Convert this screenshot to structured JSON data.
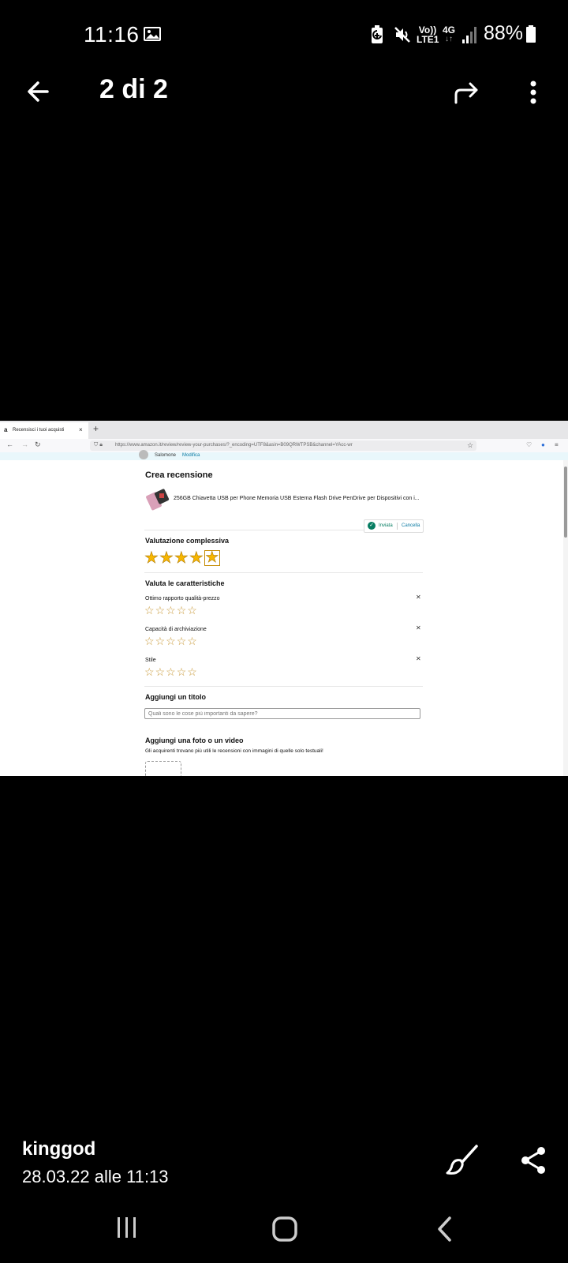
{
  "status_bar": {
    "time": "11:16",
    "volte_top": "Vo))",
    "volte_bottom": "LTE1",
    "network_type": "4G",
    "battery_percent": "88%"
  },
  "app_bar": {
    "page_counter": "2 di 2"
  },
  "screenshot": {
    "browser": {
      "tab_title": "Recensisci i tuoi acquisti",
      "url": "https://www.amazon.it/review/review-your-purchases/?_encoding=UTF8&asin=B09QRWTPSB&channel=YAcc-wr"
    },
    "user_bar": {
      "name": "Salomone",
      "edit_link": "Modifica"
    },
    "review": {
      "heading": "Crea recensione",
      "product_title": "256GB Chiavetta USB per Phone Memoria USB Esterna Flash Drive PenDrive per Dispositivi con i...",
      "overall_heading": "Valutazione complessiva",
      "overall_rating": 4.5,
      "status_sent": "Inviata",
      "status_cancel": "Cancella",
      "features_heading": "Valuta le caratteristiche",
      "features": [
        {
          "label": "Ottimo rapporto qualità-prezzo",
          "rating": 0
        },
        {
          "label": "Capacità di archiviazione",
          "rating": 0
        },
        {
          "label": "Stile",
          "rating": 0
        }
      ],
      "title_heading": "Aggiungi un titolo",
      "title_placeholder": "Quali sono le cose più importanti da sapere?",
      "media_heading": "Aggiungi una foto o un video",
      "media_hint": "Gli acquirenti trovano più utili le recensioni con immagini di quelle solo testuali!"
    }
  },
  "info": {
    "owner": "kinggod",
    "date_time": "28.03.22 alle 11:13"
  },
  "colors": {
    "background": "#000000",
    "star_fill": "#f7b600",
    "amazon_link": "#0a7aa3",
    "sent_green": "#067d62"
  }
}
